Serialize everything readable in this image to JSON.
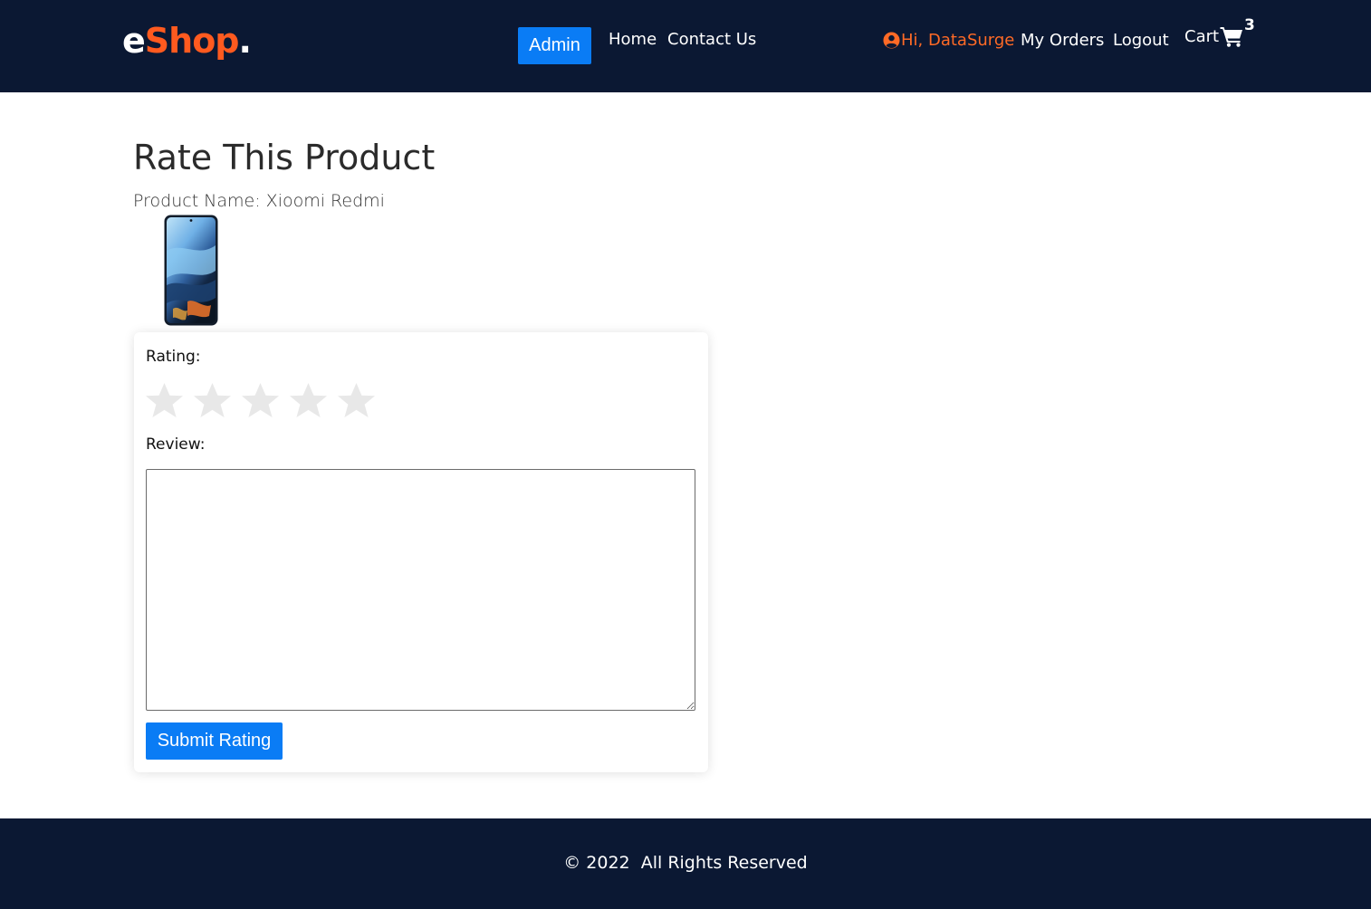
{
  "brand": {
    "e": "e",
    "shop": "Shop",
    "dot": "."
  },
  "nav": {
    "admin_label": "Admin",
    "home_label": "Home",
    "contact_label": "Contact Us",
    "greeting": "Hi, DataSurge",
    "orders_label": "My Orders",
    "logout_label": "Logout",
    "cart_label": "Cart",
    "cart_count": "3"
  },
  "page": {
    "title": "Rate This Product",
    "product_name": "Product Name: Xioomi Redmi"
  },
  "form": {
    "rating_label": "Rating:",
    "rating_value": 0,
    "rating_max": 5,
    "review_label": "Review:",
    "review_value": "",
    "submit_label": "Submit Rating"
  },
  "footer": {
    "text": "© 2022  All Rights Reserved"
  },
  "colors": {
    "navbar_bg": "#0b1833",
    "brand_accent": "#ff5a1f",
    "greeting": "#ff6a26",
    "primary_button": "#0a7cf5",
    "star_empty": "#e8e8e8"
  },
  "icons": {
    "user": "user-circle-icon",
    "cart": "shopping-cart-icon",
    "star": "star-icon"
  }
}
